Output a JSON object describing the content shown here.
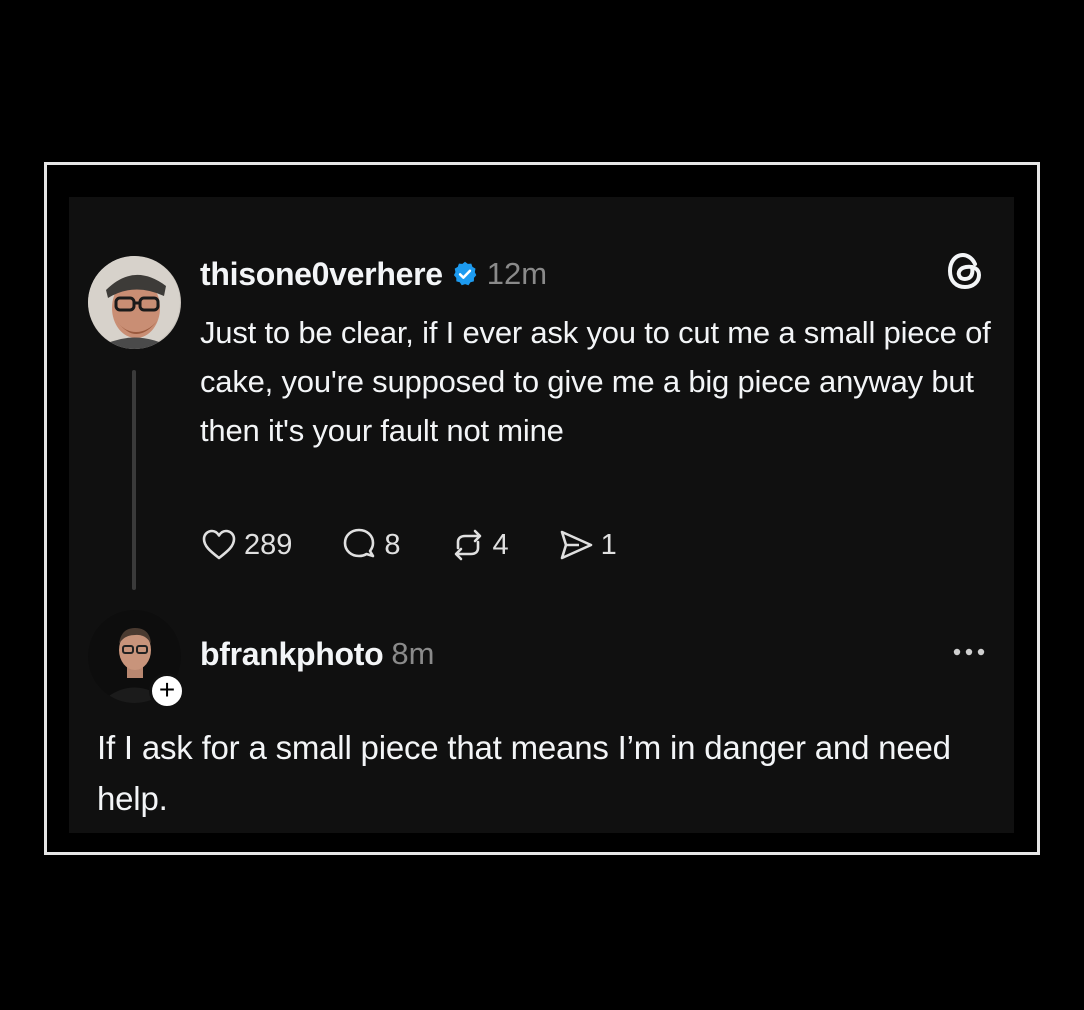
{
  "post": {
    "username": "thisone0verhere",
    "verified": true,
    "time": "12m",
    "text": "Just to be clear, if I ever ask you to cut me a small piece of cake, you're supposed to give me a big piece anyway but then it's your fault not mine",
    "actions": {
      "likes": "289",
      "replies": "8",
      "reposts": "4",
      "shares": "1"
    }
  },
  "reply": {
    "username": "bfrankphoto",
    "time": "8m",
    "text": "If I ask for a small piece that means I’m in danger and need help.",
    "follow_badge": "+"
  },
  "icons": {
    "brand": "threads-logo-icon",
    "verified": "verified-badge-icon",
    "like": "heart-icon",
    "reply": "comment-icon",
    "repost": "repost-icon",
    "share": "send-icon",
    "more": "more-options-icon"
  },
  "colors": {
    "background": "#000000",
    "card": "#101010",
    "border": "#e6e6e6",
    "text": "#f3f5f7",
    "muted": "#8a8a8a",
    "verified": "#1d9bf0"
  }
}
